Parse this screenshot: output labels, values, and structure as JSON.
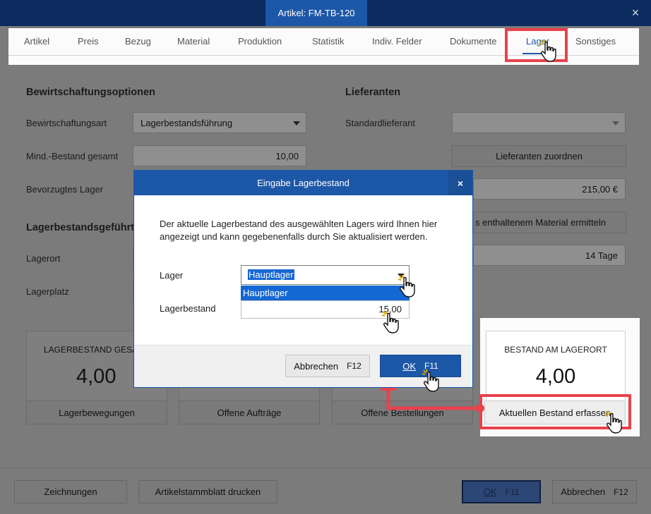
{
  "window": {
    "title": "Artikel: FM-TB-120",
    "close_glyph": "×"
  },
  "tabs": [
    {
      "label": "Artikel"
    },
    {
      "label": "Preis"
    },
    {
      "label": "Bezug"
    },
    {
      "label": "Material"
    },
    {
      "label": "Produktion"
    },
    {
      "label": "Statistik"
    },
    {
      "label": "Indiv. Felder"
    },
    {
      "label": "Dokumente"
    },
    {
      "label": "Lager"
    },
    {
      "label": "Sonstiges"
    }
  ],
  "bewirtschaftung": {
    "heading": "Bewirtschaftungsoptionen",
    "art_label": "Bewirtschaftungsart",
    "art_value": "Lagerbestandsführung",
    "mind_label": "Mind.-Bestand gesamt",
    "mind_value": "10,00",
    "bevorzugt_label": "Bevorzugtes Lager"
  },
  "lagerbestand_section": {
    "heading": "Lagerbestandsgeführte",
    "lagerort_label": "Lagerort",
    "lagerplatz_label": "Lagerplatz"
  },
  "lieferanten": {
    "heading": "Lieferanten",
    "standard_label": "Standardlieferant",
    "zuordnen_button": "Lieferanten zuordnen",
    "price_value": "215,00 €",
    "material_button": "s enthaltenem Material ermitteln",
    "tage_value": "14 Tage"
  },
  "cards": {
    "gesamt_title": "LAGERBESTAND GESA",
    "gesamt_value": "4,00",
    "bewegungen_button": "Lagerbewegungen",
    "auftraege_button": "Offene Aufträge",
    "bestellungen_button": "Offene Bestellungen",
    "lagerort_title": "BESTAND AM LAGERORT",
    "lagerort_value": "4,00",
    "erfassen_button": "Aktuellen Bestand erfassen"
  },
  "dialog": {
    "title": "Eingabe Lagerbestand",
    "close_glyph": "×",
    "message": "Der aktuelle Lagerbestand des ausgewählten Lagers wird Ihnen hier angezeigt und kann gegebenenfalls durch Sie aktualisiert werden.",
    "lager_label": "Lager",
    "lager_value": "Hauptlager",
    "lager_option": "Hauptlager",
    "bestand_label": "Lagerbestand",
    "bestand_value": "15,00",
    "cancel_label": "Abbrechen",
    "cancel_key": "F12",
    "ok_label": "OK",
    "ok_key": "F11"
  },
  "footer": {
    "zeichnungen": "Zeichnungen",
    "stammblatt": "Artikelstammblatt drucken",
    "ok_label": "OK",
    "ok_key": "F11",
    "cancel_label": "Abbrechen",
    "cancel_key": "F12"
  },
  "colors": {
    "accent": "#1d57a8",
    "highlight": "#e8424d",
    "titlebar": "#0c2c5f"
  }
}
